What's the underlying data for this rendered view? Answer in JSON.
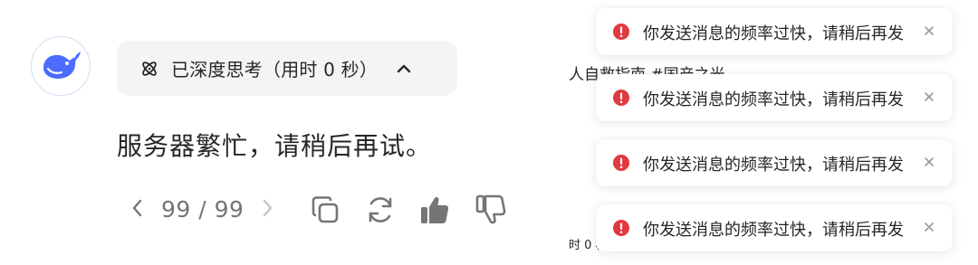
{
  "thinking": {
    "label": "已深度思考（用时 0 秒）",
    "icon": "atom-icon",
    "toggle_icon": "chevron-up-icon"
  },
  "message": {
    "text": "服务器繁忙，请稍后再试。"
  },
  "pager": {
    "text": "99 / 99"
  },
  "actions": [
    {
      "name": "copy-icon"
    },
    {
      "name": "regenerate-icon"
    },
    {
      "name": "thumbs-up-icon"
    },
    {
      "name": "thumbs-down-icon"
    }
  ],
  "background": {
    "text_top": "人自救指南 #国产之光",
    "text_bottom": "时 0 秒"
  },
  "toasts": [
    {
      "text": "你发送消息的频率过快，请稍后再发"
    },
    {
      "text": "你发送消息的频率过快，请稍后再发"
    },
    {
      "text": "你发送消息的频率过快，请稍后再发"
    },
    {
      "text": "你发送消息的频率过快，请稍后再发"
    }
  ],
  "colors": {
    "accent_blue": "#4d6bfe",
    "error_red": "#e0393e",
    "pill_bg": "#f3f4f6",
    "muted_icon": "#757575"
  }
}
